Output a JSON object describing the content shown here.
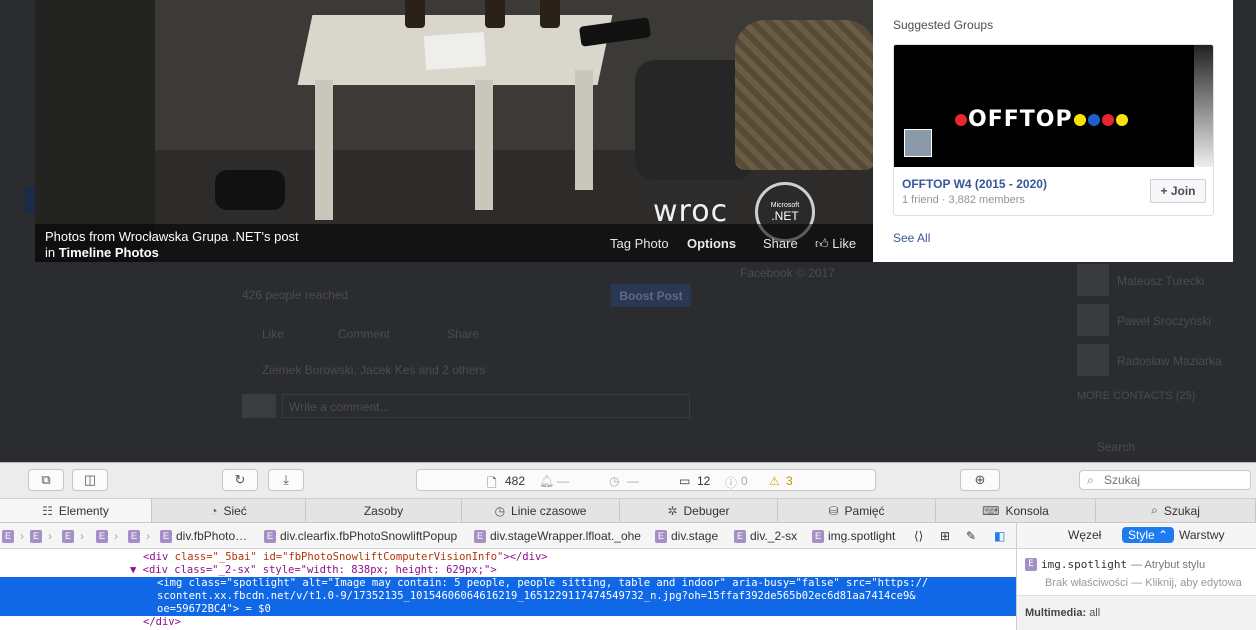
{
  "photo": {
    "caption_line1": "Photos from Wrocławska Grupa .NET's post",
    "caption_in": "in",
    "caption_album": "Timeline Photos",
    "logo_text": "wroc",
    "logo_badge_top": "Microsoft",
    "logo_badge_bottom": ".NET",
    "actions": {
      "tag": "Tag Photo",
      "options": "Options",
      "share": "Share",
      "like": "Like"
    }
  },
  "suggested_groups": {
    "title": "Suggested Groups",
    "group": {
      "cover_text": "OFFTOP",
      "name": "OFFTOP W4 (2015 - 2020)",
      "meta": "1 friend · 3,882 members",
      "join_label": "+ Join"
    },
    "see_all": "See All"
  },
  "background_feed": {
    "people_reached": "426 people reached",
    "boost_post": "Boost Post",
    "like": "Like",
    "comment": "Comment",
    "share": "Share",
    "reactions": "Ziemek Borowski, Jacek Kes and 2 others",
    "comment_placeholder": "Write a comment...",
    "footer": "Facebook © 2017",
    "contacts": [
      "Mateusz Turecki",
      "Paweł Sroczyński",
      "Radosław Maziarka"
    ],
    "more_contacts": "MORE CONTACTS (25)",
    "search": "Search"
  },
  "inspector": {
    "toolbar": {
      "resource_count": "482",
      "dash1": "—",
      "dash2": "—",
      "log_count": "12",
      "error_count": "0",
      "warning_count": "3",
      "search_placeholder": "Szukaj"
    },
    "tabs": [
      "Elementy",
      "Sieć",
      "Zasoby",
      "Linie czasowe",
      "Debuger",
      "Pamięć",
      "Konsola",
      "Szukaj"
    ],
    "breadcrumbs": [
      "div.fbPhoto…",
      "div.clearfix.fbPhotoSnowliftPopup",
      "div.stageWrapper.lfloat._ohe",
      "div.stage",
      "div._2-sx",
      "img.spotlight"
    ],
    "code": {
      "line1_tag_open": "<div",
      "line1_attrs": " class=\"_5bai\" id=\"fbPhotoSnowliftComputerVisionInfo\"",
      "line1_close": "></div>",
      "line2": "▼ <div class=\"_2-sx\" style=\"width: 838px; height: 629px;\">",
      "sel_line1": "<img class=\"spotlight\" alt=\"Image may contain: 5 people, people sitting, table and indoor\" aria-busy=\"false\" src=\"https://",
      "sel_line2": "scontent.xx.fbcdn.net/v/t1.0-9/17352135_10154606064616219_1651229117474549732_n.jpg?oh=15ffaf392de565b02ec6d81aa7414ce9&",
      "sel_line3": "oe=59672BC4\"> = $0",
      "line_close": "</div>"
    },
    "side_tabs": {
      "node": "Węzeł",
      "style": "Style ⌃",
      "layers": "Warstwy"
    },
    "style_rule": {
      "selector": "img.spotlight",
      "origin": "— Atrybut stylu",
      "hint": "Brak właściwości — Kliknij, aby edytowa",
      "media_label": "Multimedia:",
      "media_value": "all"
    }
  }
}
